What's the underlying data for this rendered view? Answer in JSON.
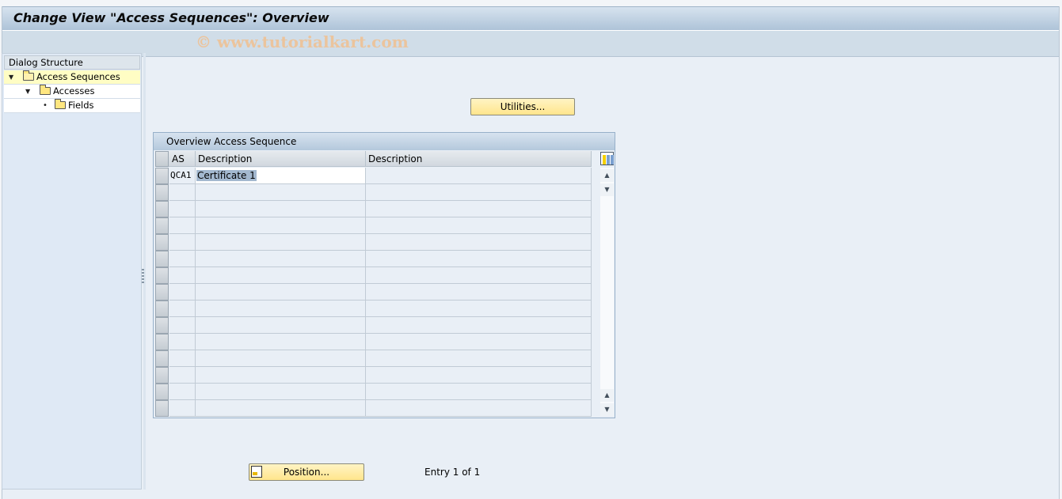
{
  "window": {
    "title": "Change View \"Access Sequences\": Overview",
    "watermark": "© www.tutorialkart.com"
  },
  "dialog_structure": {
    "header": "Dialog Structure",
    "items": [
      {
        "label": "Access Sequences",
        "level": 0,
        "expander": "▼",
        "selected": true,
        "icon": "folder-open-icon"
      },
      {
        "label": "Accesses",
        "level": 1,
        "expander": "▼",
        "selected": false,
        "icon": "folder-icon"
      },
      {
        "label": "Fields",
        "level": 2,
        "expander": "•",
        "selected": false,
        "icon": "folder-icon"
      }
    ]
  },
  "buttons": {
    "utilities": "Utilities...",
    "position": "Position..."
  },
  "table": {
    "title": "Overview Access Sequence",
    "columns": [
      "AS",
      "Description",
      "Description"
    ],
    "rows": [
      [
        "QCA1",
        "Certificate 1",
        ""
      ],
      [
        "",
        "",
        ""
      ],
      [
        "",
        "",
        ""
      ],
      [
        "",
        "",
        ""
      ],
      [
        "",
        "",
        ""
      ],
      [
        "",
        "",
        ""
      ],
      [
        "",
        "",
        ""
      ],
      [
        "",
        "",
        ""
      ],
      [
        "",
        "",
        ""
      ],
      [
        "",
        "",
        ""
      ],
      [
        "",
        "",
        ""
      ],
      [
        "",
        "",
        ""
      ],
      [
        "",
        "",
        ""
      ],
      [
        "",
        "",
        ""
      ],
      [
        "",
        "",
        ""
      ]
    ],
    "scroll_up": "▲",
    "scroll_down": "▼"
  },
  "footer": {
    "entry_text": "Entry 1 of 1"
  }
}
